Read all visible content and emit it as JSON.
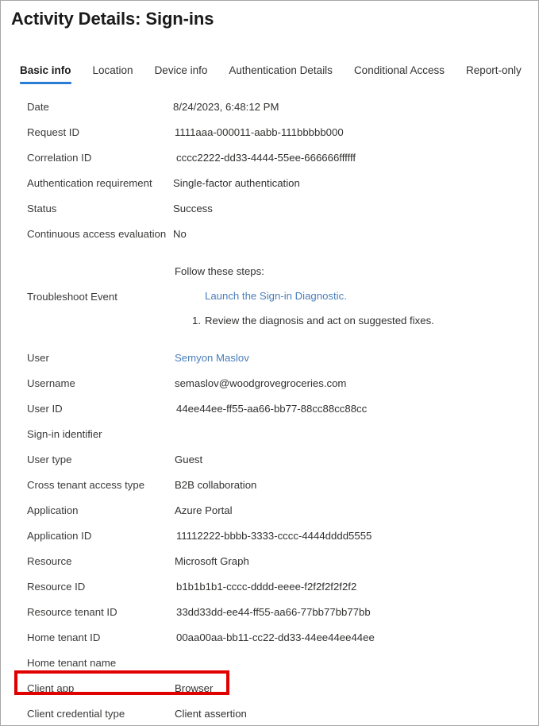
{
  "page": {
    "title": "Activity Details: Sign-ins"
  },
  "tabs": [
    {
      "label": "Basic info",
      "active": true
    },
    {
      "label": "Location",
      "active": false
    },
    {
      "label": "Device info",
      "active": false
    },
    {
      "label": "Authentication Details",
      "active": false
    },
    {
      "label": "Conditional Access",
      "active": false
    },
    {
      "label": "Report-only",
      "active": false
    }
  ],
  "details_top": [
    {
      "label": "Date",
      "value": "8/24/2023, 6:48:12 PM"
    },
    {
      "label": "Request ID",
      "value": "1111aaa-000011-aabb-111bbbbb000"
    },
    {
      "label": "Correlation ID",
      "value": "cccc2222-dd33-4444-55ee-666666ffffff"
    },
    {
      "label": "Authentication requirement",
      "value": "Single-factor authentication"
    },
    {
      "label": "Status",
      "value": "Success"
    },
    {
      "label": "Continuous access evaluation",
      "value": "No"
    }
  ],
  "troubleshoot": {
    "label": "Troubleshoot Event",
    "intro": "Follow these steps:",
    "link": "Launch the Sign-in Diagnostic.",
    "step_number": "1.",
    "step_text": "Review the diagnosis and act on suggested fixes."
  },
  "details_bottom": [
    {
      "label": "User",
      "value": "Semyon Maslov",
      "is_link": true
    },
    {
      "label": "Username",
      "value": "semaslov@woodgrovegroceries.com"
    },
    {
      "label": "User ID",
      "value": "44ee44ee-ff55-aa66-bb77-88cc88cc88cc"
    },
    {
      "label": "Sign-in identifier",
      "value": ""
    },
    {
      "label": "User type",
      "value": "Guest"
    },
    {
      "label": "Cross tenant access type",
      "value": "B2B collaboration"
    },
    {
      "label": "Application",
      "value": "Azure Portal"
    },
    {
      "label": "Application ID",
      "value": "11112222-bbbb-3333-cccc-4444dddd5555"
    },
    {
      "label": "Resource",
      "value": "Microsoft Graph"
    },
    {
      "label": "Resource ID",
      "value": "b1b1b1b1-cccc-dddd-eeee-f2f2f2f2f2f2"
    },
    {
      "label": "Resource tenant ID",
      "value": "33dd33dd-ee44-ff55-aa66-77bb77bb77bb"
    },
    {
      "label": "Home tenant ID",
      "value": "00aa00aa-bb11-cc22-dd33-44ee44ee44ee"
    },
    {
      "label": "Home tenant name",
      "value": ""
    },
    {
      "label": "Client app",
      "value": "Browser",
      "highlighted": true
    },
    {
      "label": "Client credential type",
      "value": "Client assertion"
    }
  ],
  "colors": {
    "accent_blue": "#2b7cd3",
    "link_blue": "#4a7ebb",
    "highlight_red": "#e00000",
    "frame_border": "#a6a6a6",
    "text": "#323130",
    "label_text": "#3b3a39"
  }
}
